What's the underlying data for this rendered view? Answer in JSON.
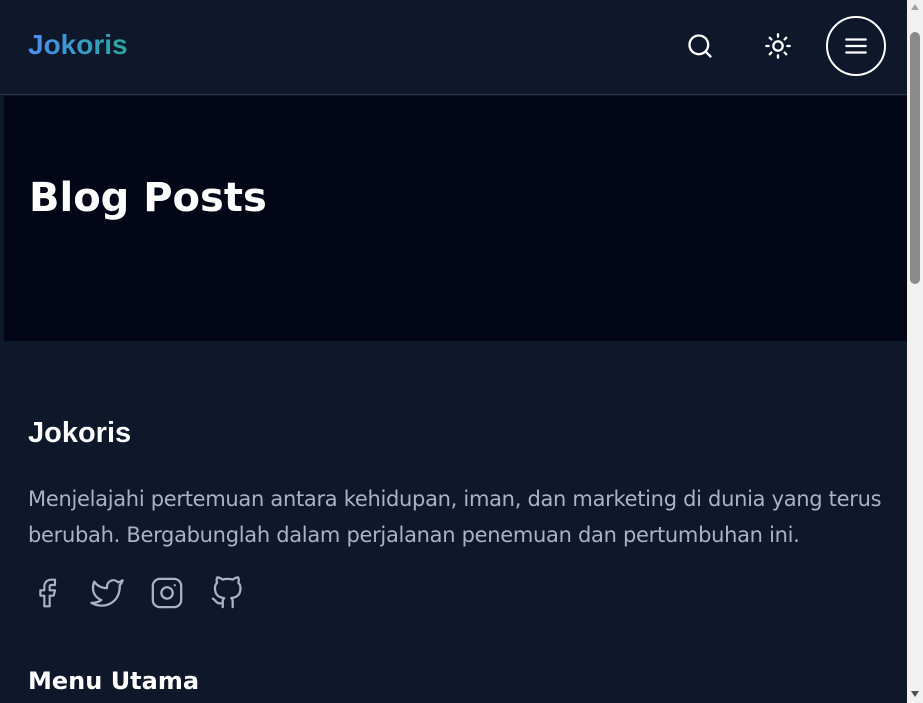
{
  "header": {
    "logo": "Jokoris",
    "search_icon": "search-icon",
    "theme_icon": "sun-icon",
    "menu_icon": "hamburger-menu-icon"
  },
  "hero": {
    "title": "Blog Posts"
  },
  "footer": {
    "title": "Jokoris",
    "description": "Menjelajahi pertemuan antara kehidupan, iman, dan marketing di dunia yang terus berubah. Bergabunglah dalam perjalanan penemuan dan pertumbuhan ini.",
    "socials": [
      "facebook-icon",
      "twitter-icon",
      "instagram-icon",
      "github-icon"
    ],
    "menu_title": "Menu Utama"
  },
  "colors": {
    "background": "#0f172a",
    "hero_background": "#020617",
    "text": "#ffffff",
    "muted_text": "#a8b4c6",
    "logo_gradient_start": "#4a8df0",
    "logo_gradient_end": "#2aa79b"
  }
}
